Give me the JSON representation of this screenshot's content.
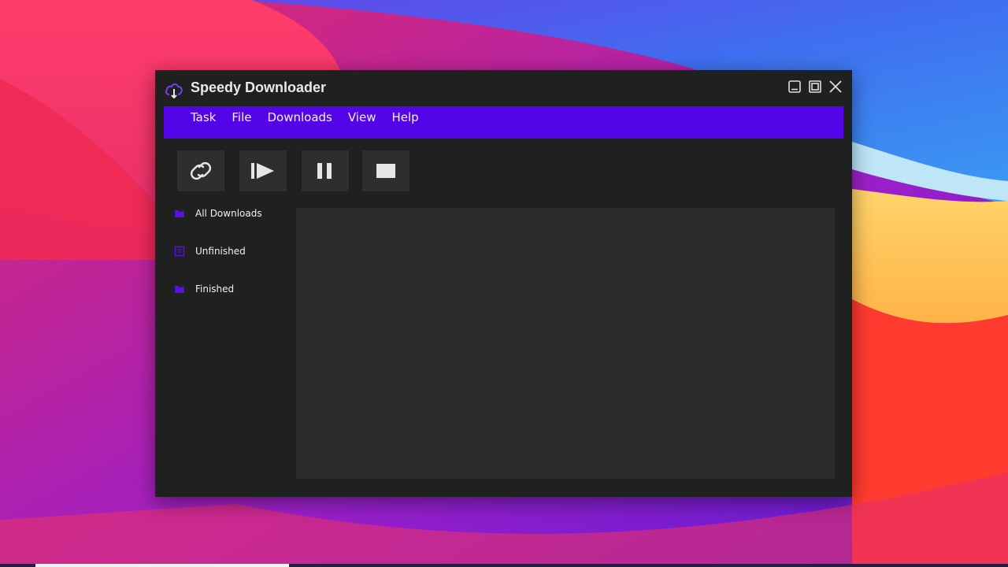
{
  "window": {
    "title": "Speedy Downloader"
  },
  "menu": {
    "items": [
      "Task",
      "File",
      "Downloads",
      "View",
      "Help"
    ]
  },
  "toolbar": {
    "buttons": [
      {
        "icon": "link-icon"
      },
      {
        "icon": "resume-icon"
      },
      {
        "icon": "pause-icon"
      },
      {
        "icon": "stop-icon"
      }
    ]
  },
  "sidebar": {
    "items": [
      {
        "label": "All Downloads",
        "icon": "folder-icon"
      },
      {
        "label": "Unfinished",
        "icon": "pending-icon"
      },
      {
        "label": "Finished",
        "icon": "folder-icon"
      }
    ]
  },
  "colors": {
    "accent": "#5305e8",
    "window_bg": "#1f2020",
    "panel_bg": "#2b2b2b",
    "button_bg": "#2e2e2e",
    "text": "#f0f0f0"
  }
}
